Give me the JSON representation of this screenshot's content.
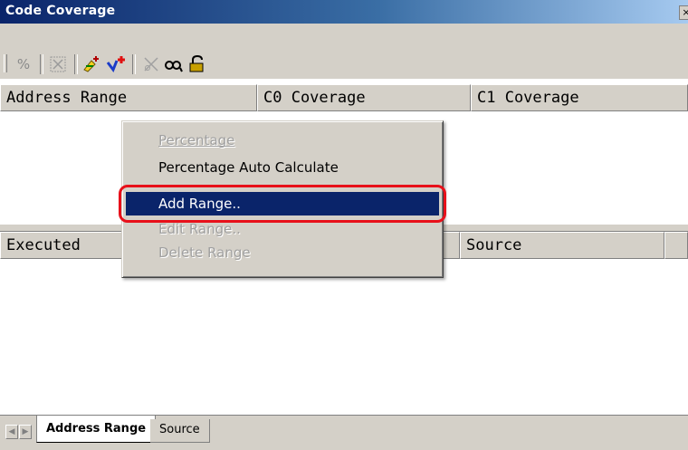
{
  "window": {
    "title": "Code Coverage",
    "close_glyph": "×"
  },
  "toolbar": {
    "buttons": [
      {
        "icon": "percent-icon",
        "glyph": "%"
      },
      {
        "icon": "percent-auto-icon"
      },
      {
        "icon": "add-range-icon"
      },
      {
        "icon": "add-source-icon"
      },
      {
        "icon": "clear-icon"
      },
      {
        "icon": "find-icon"
      },
      {
        "icon": "lock-icon"
      }
    ]
  },
  "top_table": {
    "columns": [
      "Address Range",
      "C0 Coverage",
      "C1 Coverage"
    ]
  },
  "bottom_table": {
    "columns": [
      "Executed",
      "Source"
    ]
  },
  "context_menu": {
    "items": [
      {
        "label": "Percentage",
        "mnemonic": "P",
        "state": "disabled"
      },
      {
        "label": "Percentage Auto Calculate",
        "mnemonic": "C",
        "state": "enabled"
      },
      {
        "label": "Add Range..",
        "mnemonic": "A",
        "state": "selected"
      },
      {
        "label": "Edit Range..",
        "mnemonic": "E",
        "state": "disabled"
      },
      {
        "label": "Delete Range",
        "mnemonic": "D",
        "state": "disabled"
      }
    ],
    "highlight_color": "#e8101a",
    "selection_color": "#0a246a"
  },
  "tabs": [
    {
      "label": "Address Range",
      "active": true
    },
    {
      "label": "Source",
      "active": false
    }
  ],
  "colors": {
    "face": "#d4d0c8",
    "title_start": "#0a246a",
    "title_end": "#a6caf0"
  }
}
